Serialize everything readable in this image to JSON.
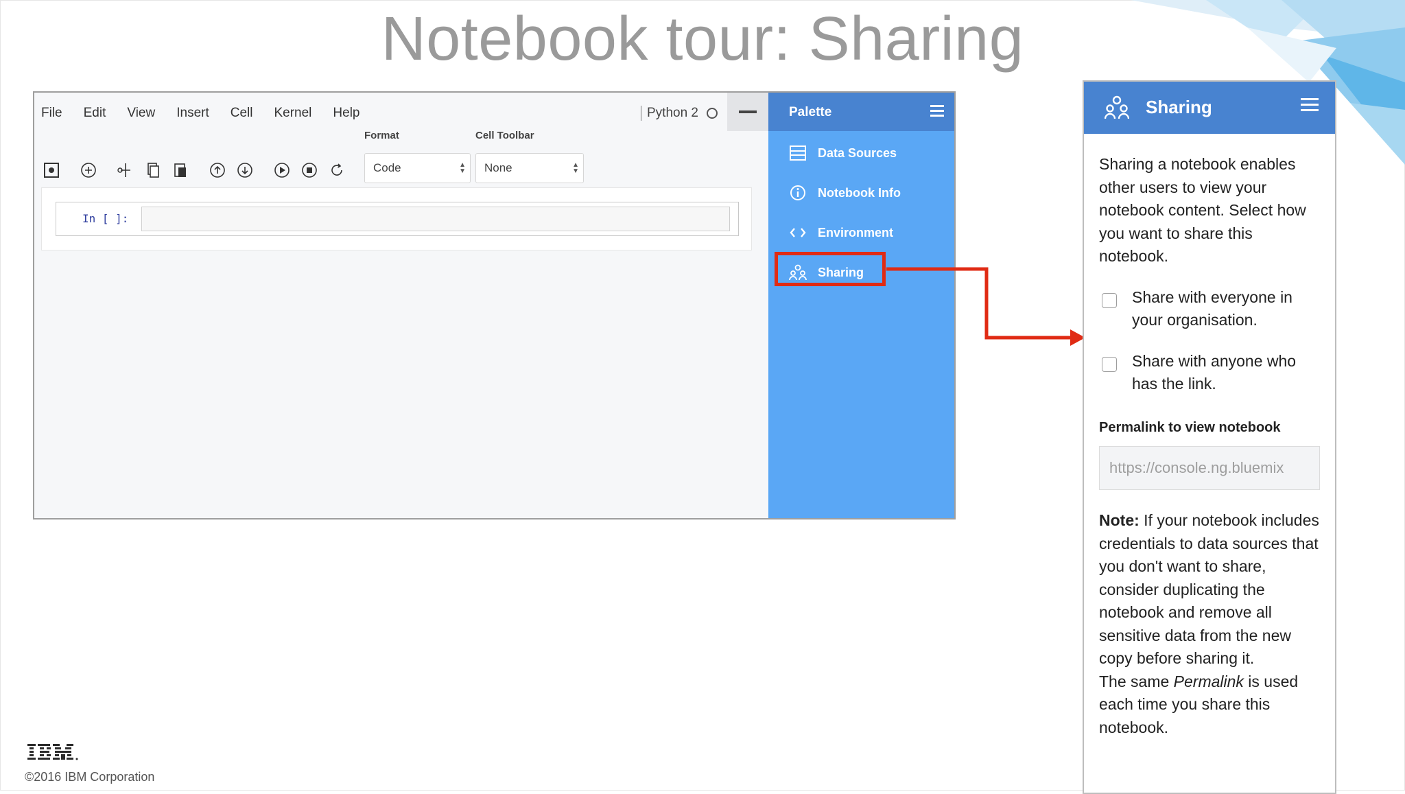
{
  "slide": {
    "title": "Notebook tour: Sharing",
    "logo": "IBM",
    "copyright": "©2016 IBM Corporation"
  },
  "notebook": {
    "menu": [
      "File",
      "Edit",
      "View",
      "Insert",
      "Cell",
      "Kernel",
      "Help"
    ],
    "kernel": "Python 2",
    "format_label": "Format",
    "format_value": "Code",
    "cell_toolbar_label": "Cell Toolbar",
    "cell_toolbar_value": "None",
    "cell_prompt": "In [ ]:"
  },
  "palette": {
    "title": "Palette",
    "items": [
      {
        "label": "Data Sources",
        "icon": "data-sources-icon"
      },
      {
        "label": "Notebook Info",
        "icon": "info-icon"
      },
      {
        "label": "Environment",
        "icon": "code-brackets-icon"
      },
      {
        "label": "Sharing",
        "icon": "sharing-users-icon"
      }
    ]
  },
  "sharing_panel": {
    "title": "Sharing",
    "description": "Sharing a notebook enables other users to view your notebook content. Select how you want to share this notebook.",
    "options": [
      {
        "label": "Share with everyone in your organisation.",
        "checked": false
      },
      {
        "label": "Share with anyone who has the link.",
        "checked": false
      }
    ],
    "permalink_label": "Permalink to view notebook",
    "permalink_value": "https://console.ng.bluemix",
    "note_label": "Note:",
    "note_text": " If your notebook includes credentials to data sources that you don't want to share, consider duplicating the notebook and remove all sensitive data from the new copy before sharing it.",
    "footer_pre": "The same ",
    "footer_em": "Permalink",
    "footer_post": " is used each time you share this notebook."
  },
  "colors": {
    "palette_bg": "#5aa7f5",
    "header_bg": "#4883d0",
    "highlight": "#e02b14",
    "title_gray": "#9a9a9a"
  }
}
